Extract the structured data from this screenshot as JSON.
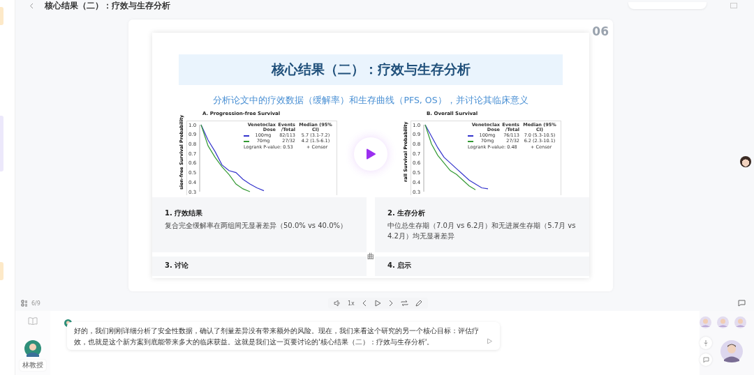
{
  "header": {
    "title": "核心结果（二）：疗效与生存分析"
  },
  "slide": {
    "number": "06",
    "title": "核心结果（二）：疗效与生存分析",
    "subtitle": "分析论文中的疗效数据（缓解率）和生存曲线（PFS, OS），并讨论其临床意义",
    "charts": [
      {
        "ylabel": "sion-free Survival Probability",
        "legend_head": [
          "Venetoclax Dose",
          "Events /Total",
          "Median (95% CI)"
        ],
        "legend_rows": [
          [
            "82/113",
            "5.7 (3.1-7.2)"
          ],
          [
            "27/32",
            "4.2 (1.5-6.1)"
          ]
        ],
        "pvalue": "Logrank P-value: 0.53",
        "censor": "+ Censor",
        "chart_data": {
          "type": "line",
          "title": "A. Progression-free Survival",
          "legend": true,
          "ylim": [
            0.3,
            1.0
          ],
          "yticks": [
            0.3,
            0.4,
            0.5,
            0.6,
            0.7,
            0.8,
            0.9,
            {
              "value": 1,
              "label": "1.0"
            }
          ],
          "series": [
            {
              "name": "100mg",
              "color": "#3333cc",
              "values": [
                1.0,
                0.84,
                0.72,
                0.58,
                0.52,
                0.5,
                0.43,
                0.38,
                0.34,
                0.31
              ]
            },
            {
              "name": "70mg",
              "color": "#339933",
              "values": [
                1.0,
                0.78,
                0.66,
                0.56,
                0.48,
                0.38,
                0.33,
                0.3,
                null,
                null
              ]
            }
          ]
        }
      },
      {
        "ylabel": "rall Survival Probability",
        "legend_head": [
          "Venetoclax Dose",
          "Events /Total",
          "Median (95% CI)"
        ],
        "legend_rows": [
          [
            "76/113",
            "7.0 (5.3-10.5)"
          ],
          [
            "27/32",
            "6.2 (2.3-10.1)"
          ]
        ],
        "pvalue": "Logrank P-value: 0.48",
        "censor": "+ Censor",
        "chart_data": {
          "type": "line",
          "title": "B. Overall Survival",
          "legend": true,
          "ylim": [
            0.3,
            1.0
          ],
          "yticks": [
            0.3,
            0.4,
            0.5,
            0.6,
            0.7,
            0.8,
            0.9,
            {
              "value": 1,
              "label": "1.0"
            }
          ],
          "series": [
            {
              "name": "100mg",
              "color": "#3333cc",
              "values": [
                1.0,
                0.88,
                0.76,
                0.66,
                0.6,
                0.54,
                0.48,
                0.42,
                0.38,
                0.34,
                0.33
              ]
            },
            {
              "name": "70mg",
              "color": "#339933",
              "values": [
                1.0,
                0.8,
                0.68,
                0.6,
                0.52,
                0.48,
                0.42,
                0.36,
                0.32,
                null,
                null
              ]
            }
          ]
        }
      }
    ],
    "caption": "曲",
    "cards": [
      {
        "title": "1. 疗效结果",
        "text": "复合完全缓解率在两组间无显著差异（50.0% vs 40.0%）"
      },
      {
        "title": "2. 生存分析",
        "text": "中位总生存期（7.0月 vs 6.2月）和无进展生存期（5.7月 vs 4.2月）均无显著差异"
      },
      {
        "title": "3. 讨论"
      },
      {
        "title": "4. 启示"
      }
    ]
  },
  "player": {
    "page": "6/9",
    "speed": "1x"
  },
  "chat": {
    "speaker": "林教授",
    "message": "好的，我们刚刚详细分析了安全性数据，确认了剂量差异没有带来额外的风险。现在，我们来看这个研究的另一个核心目标：评估疗效，也就是这个新方案到底能带来多大的临床获益。这就是我们这一页要讨论的'核心结果（二）：疗效与生存分析'。"
  }
}
